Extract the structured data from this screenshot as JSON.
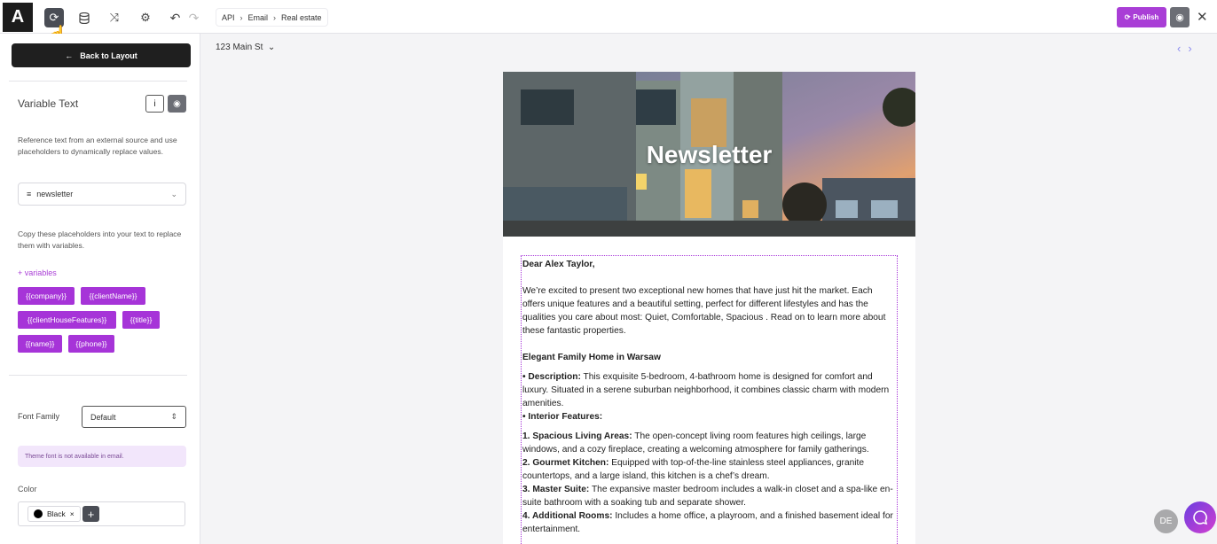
{
  "app": {
    "logo": "A"
  },
  "breadcrumb": [
    "API",
    "Email",
    "Real estate"
  ],
  "toolbar": {
    "publish_label": "Publish"
  },
  "panel": {
    "back_label": "Back to Layout",
    "title": "Variable Text",
    "description": "Reference text from an external source and use placeholders to dynamically replace values.",
    "source_select": "newsletter",
    "copy_hint": "Copy these placeholders into your text to replace them with variables.",
    "add_variables": "+ variables",
    "chips": [
      "{{company}}",
      "{{clientName}}",
      "{{clientHouseFeatures}}",
      "{{title}}",
      "{{name}}",
      "{{phone}}"
    ],
    "font_family_label": "Font Family",
    "font_family_value": "Default",
    "theme_notice": "Theme font is not available in email.",
    "color_label": "Color",
    "color_value": "Black"
  },
  "canvas": {
    "address": "123 Main St",
    "hero_title": "Newsletter",
    "greeting": "Dear Alex Taylor,",
    "intro": "We’re excited to present two exceptional new homes that have just hit the market. Each offers unique features and a beautiful setting, perfect for different lifestyles and has the qualities you care about most: Quiet, Comfortable, Spacious . Read on to learn more about these fantastic properties.",
    "heading": "Elegant Family Home in Warsaw",
    "desc_label": "• Description:",
    "desc_text": " This exquisite 5-bedroom, 4-bathroom home is designed for comfort and luxury. Situated in a serene suburban neighborhood, it combines classic charm with modern amenities.",
    "interior_label": "• Interior Features:",
    "items": [
      {
        "label": "1. Spacious Living Areas:",
        "text": " The open-concept living room features high ceilings, large windows, and a cozy fireplace, creating a welcoming atmosphere for family gatherings."
      },
      {
        "label": "2. Gourmet Kitchen:",
        "text": " Equipped with top-of-the-line stainless steel appliances, granite countertops, and a large island, this kitchen is a chef’s dream."
      },
      {
        "label": "3. Master Suite:",
        "text": " The expansive master bedroom includes a walk-in closet and a spa-like en-suite bathroom with a soaking tub and separate shower."
      },
      {
        "label": "4. Additional Rooms:",
        "text": " Includes a home office, a playroom, and a finished basement ideal for entertainment."
      }
    ]
  },
  "user": {
    "initials": "DE"
  },
  "colors": {
    "accent": "#a634d8",
    "dark": "#1f1f1f"
  }
}
